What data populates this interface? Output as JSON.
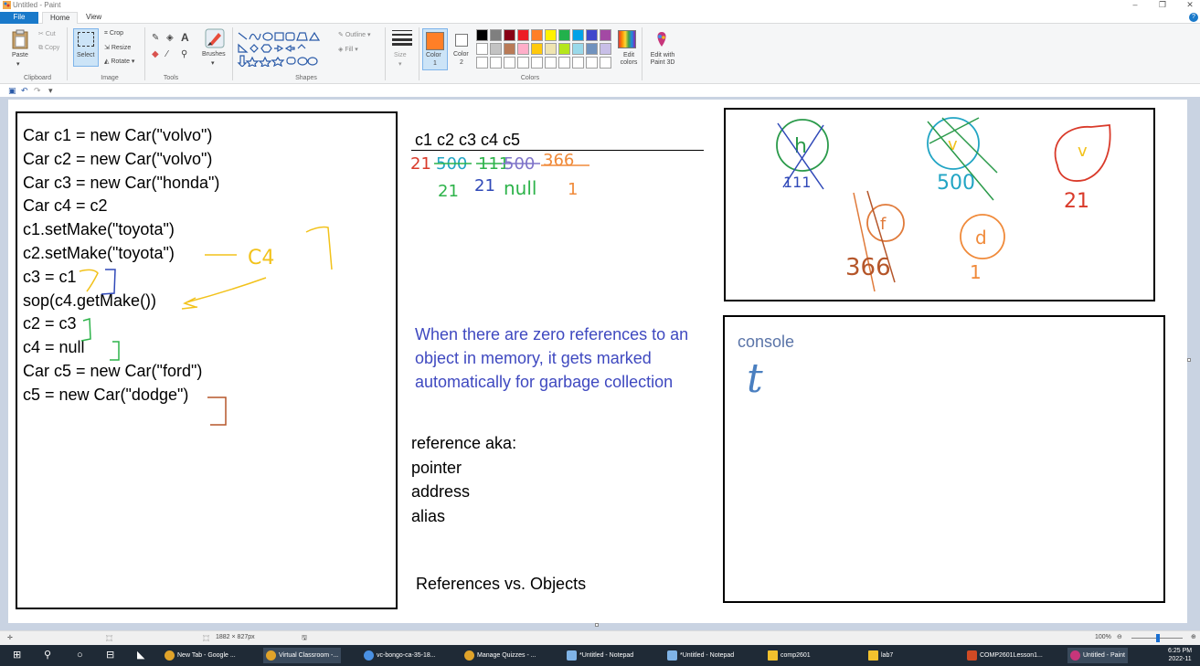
{
  "window": {
    "title": "Untitled - Paint"
  },
  "menu": {
    "tabs": [
      "File",
      "Home",
      "View"
    ]
  },
  "ribbon": {
    "clipboard": {
      "label": "Clipboard",
      "paste": "Paste",
      "cut": "Cut",
      "copy": "Copy"
    },
    "image": {
      "label": "Image",
      "select": "Select",
      "crop": "Crop",
      "resize": "Resize",
      "rotate": "Rotate"
    },
    "tools": {
      "label": "Tools"
    },
    "brushes": {
      "label": "Brushes"
    },
    "shapes": {
      "label": "Shapes",
      "outline": "Outline",
      "fill": "Fill"
    },
    "size": {
      "label": "Size"
    },
    "color1": {
      "label": "Color",
      "num": "1"
    },
    "color2": {
      "label": "Color",
      "num": "2"
    },
    "colors": {
      "label": "Colors",
      "edit": "Edit colors",
      "paint3d": "Edit with Paint 3D"
    },
    "palette_row1": [
      "#000000",
      "#7f7f7f",
      "#880015",
      "#ed1c24",
      "#ff7f27",
      "#fff200",
      "#22b14c",
      "#00a2e8",
      "#3f48cc",
      "#a349a4"
    ],
    "palette_row2": [
      "#ffffff",
      "#c3c3c3",
      "#b97a57",
      "#ffaec9",
      "#ffc90e",
      "#efe4b0",
      "#b5e61d",
      "#99d9ea",
      "#7092be",
      "#c8bfe7"
    ],
    "color1_value": "#ff7f27",
    "color2_value": "#ffffff"
  },
  "canvas": {
    "code_lines": [
      "Car c1 = new Car(\"volvo\")",
      "Car c2 = new Car(\"volvo\")",
      "Car c3 = new Car(\"honda\")",
      "Car c4 = c2",
      "c1.setMake(\"toyota\")",
      "c2.setMake(\"toyota\")",
      "c3 = c1",
      "sop(c4.getMake())",
      "c2 = c3",
      "c4 = null",
      "Car c5 = new Car(\"ford\")",
      "c5 = new Car(\"dodge\")"
    ],
    "ref_header": "c1  c2  c3  c4  c5",
    "gc_note": "When there are zero references to an object in memory, it gets marked automatically for garbage collection",
    "aka_title": "reference aka:",
    "aka_items": [
      "pointer",
      "address",
      "alias"
    ],
    "footer_title": "References vs. Objects",
    "console_label": "console",
    "handwritten": {
      "c4_note": "C4",
      "row1": [
        "21",
        "500",
        "111",
        "500",
        "366"
      ],
      "row2": [
        "21",
        "21",
        "null",
        "1"
      ],
      "obj_h": "h",
      "obj_h_ref": "111",
      "obj_v1": "v",
      "obj_v1_ref": "500",
      "obj_v2": "v",
      "obj_v2_ref": "21",
      "obj_f": "f",
      "obj_f_ref": "366",
      "obj_d": "d",
      "obj_d_ref": "1",
      "console_output": "t"
    }
  },
  "status": {
    "size": "1882 × 827px",
    "zoom": "100%"
  },
  "taskbar": {
    "items": [
      "New Tab - Google ...",
      "Virtual Classroom -...",
      "vc-bongo-ca-35-18...",
      "Manage Quizzes - ...",
      "*Untitled - Notepad",
      "*Untitled - Notepad",
      "comp2601",
      "lab7",
      "COMP2601Lesson1...",
      "Untitled - Paint"
    ],
    "time": "6:25 PM",
    "date": "2022-11"
  }
}
